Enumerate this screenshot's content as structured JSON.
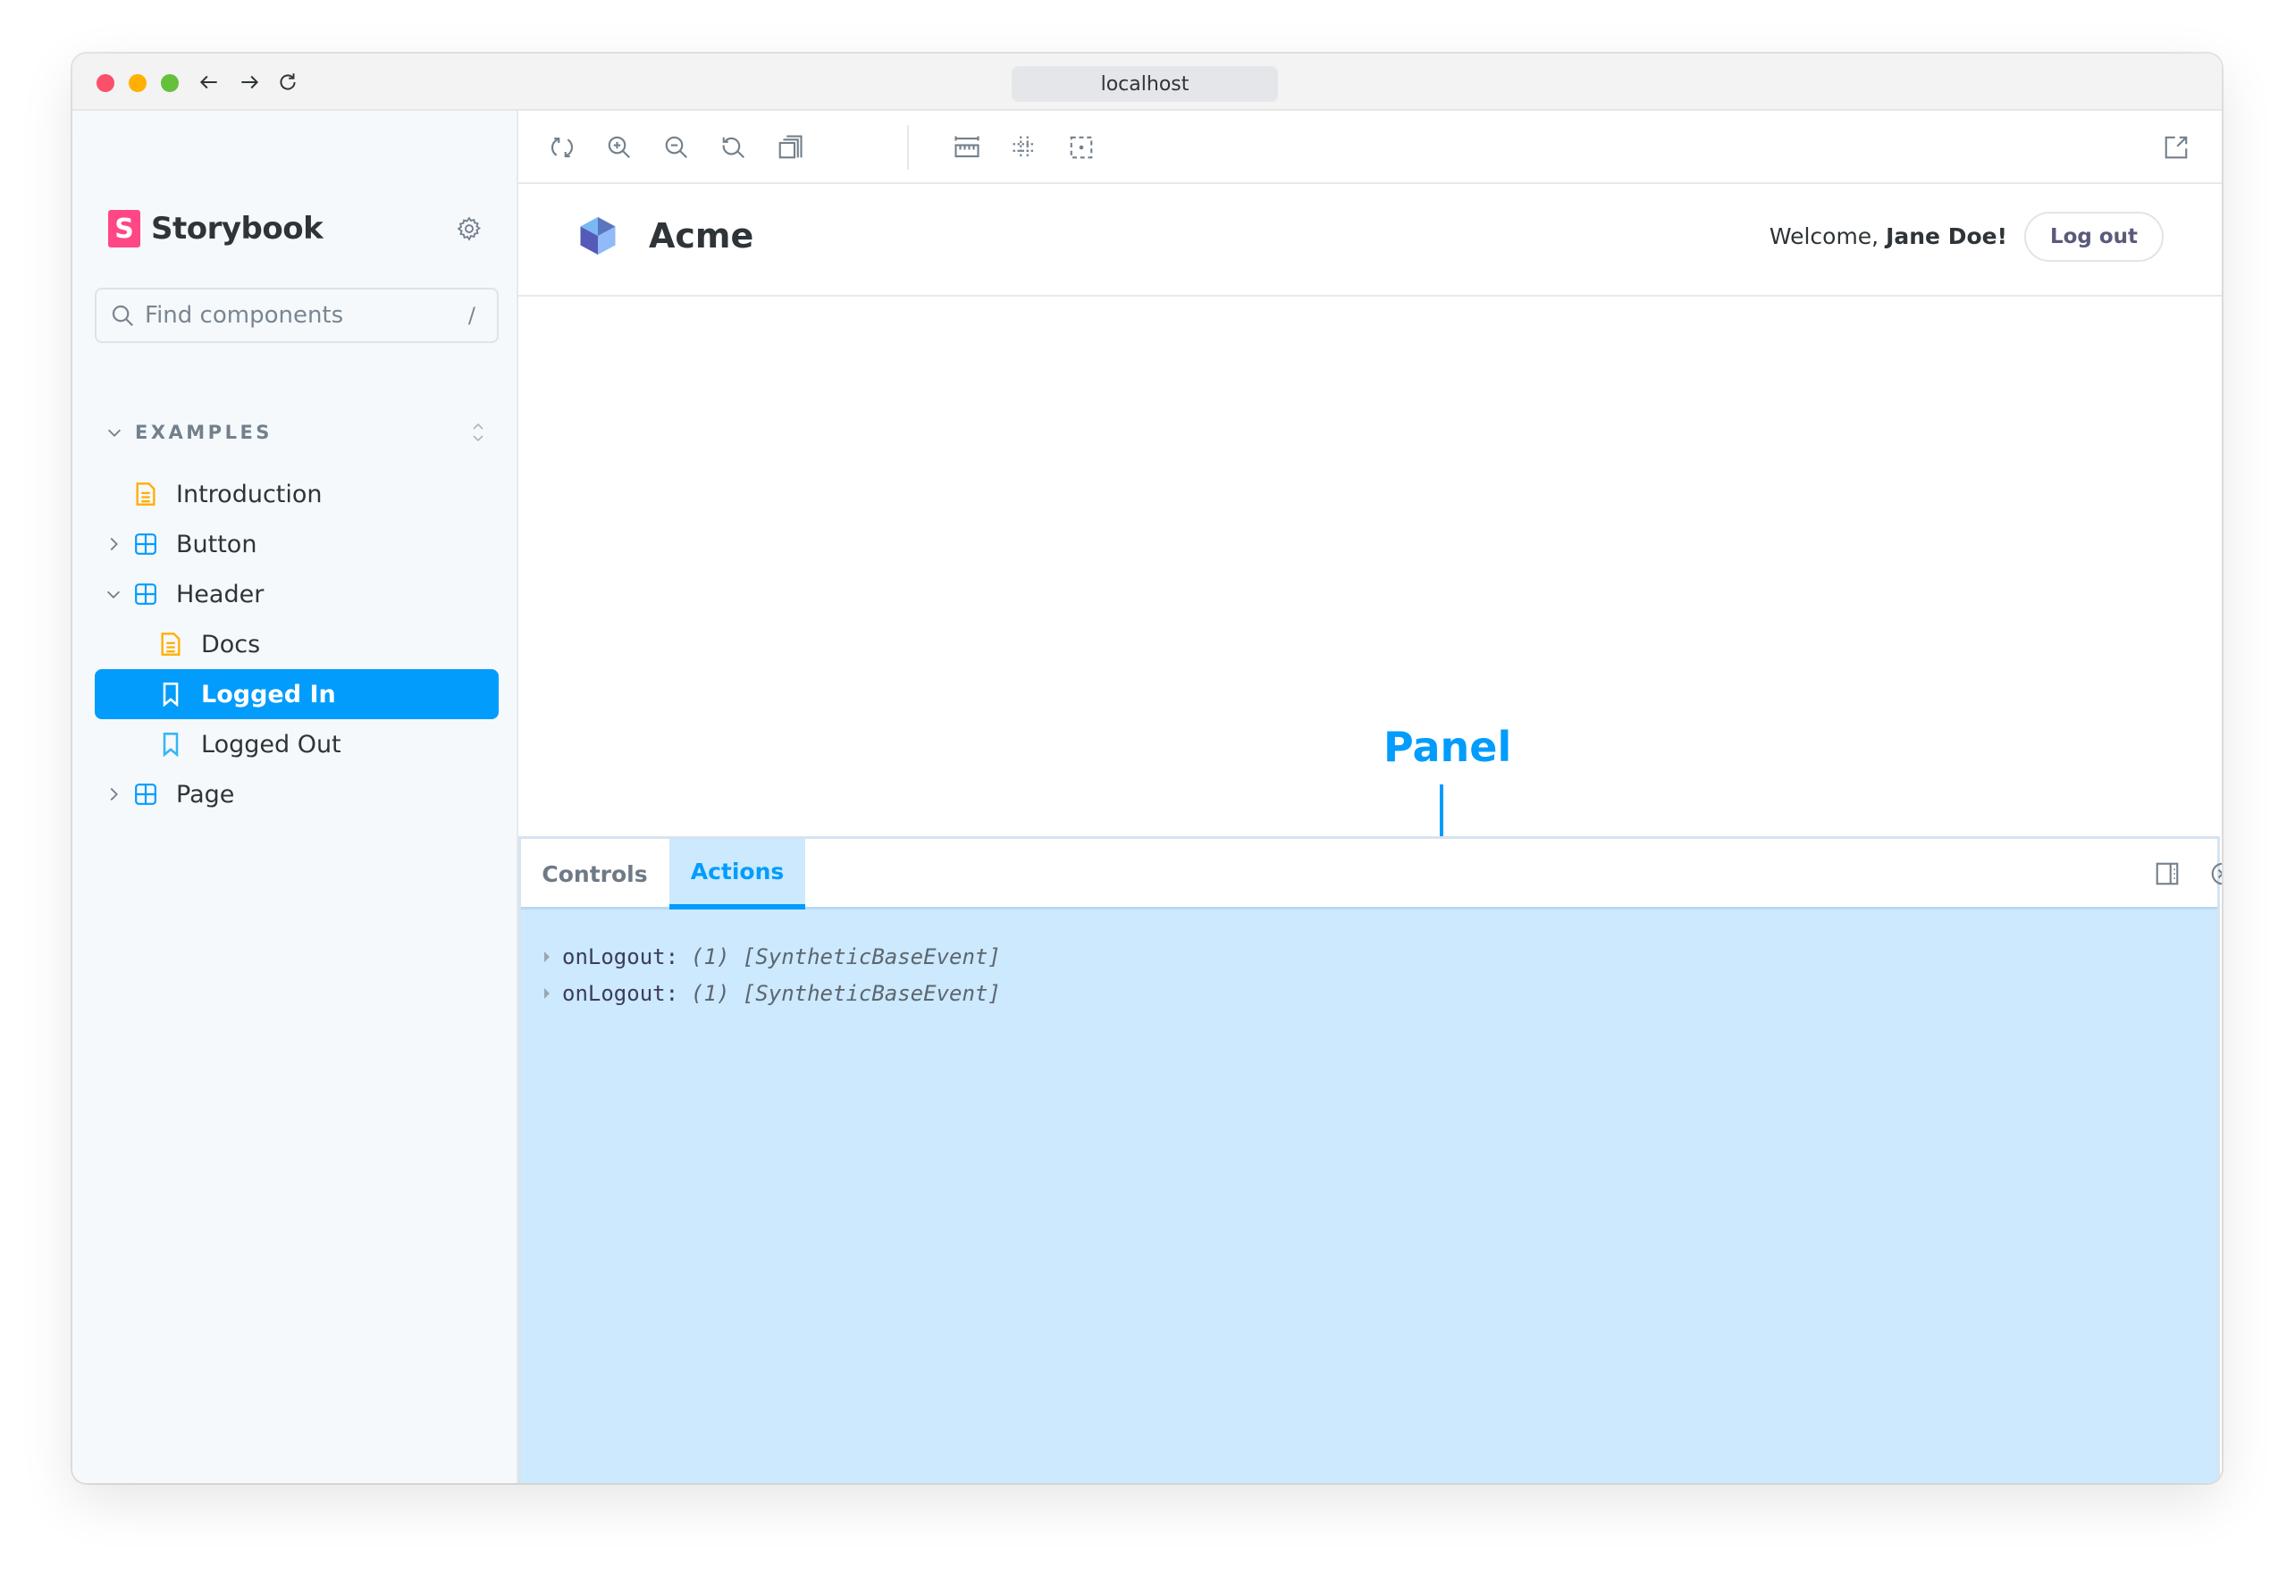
{
  "browser": {
    "url": "localhost",
    "nav": {
      "back_icon": "arrow-left-icon",
      "forward_icon": "arrow-right-icon",
      "reload_icon": "reload-icon"
    },
    "traffic_lights": {
      "close": "#fb4f6b",
      "minimize": "#ffb000",
      "zoom": "#65c03c"
    }
  },
  "sidebar": {
    "brand": {
      "logo_letter": "S",
      "name": "Storybook",
      "logo_color": "#ff4785"
    },
    "settings_icon": "gear-icon",
    "search": {
      "placeholder": "Find components",
      "value": "",
      "shortcut": "/"
    },
    "section": {
      "label": "EXAMPLES",
      "expanded": true
    },
    "items": [
      {
        "label": "Introduction",
        "type": "docs",
        "depth": 0,
        "expandable": false
      },
      {
        "label": "Button",
        "type": "component",
        "depth": 0,
        "expandable": true,
        "expanded": false
      },
      {
        "label": "Header",
        "type": "component",
        "depth": 0,
        "expandable": true,
        "expanded": true
      },
      {
        "label": "Docs",
        "type": "docs",
        "depth": 1,
        "expandable": false
      },
      {
        "label": "Logged In",
        "type": "story",
        "depth": 1,
        "selected": true
      },
      {
        "label": "Logged Out",
        "type": "story",
        "depth": 1
      },
      {
        "label": "Page",
        "type": "component",
        "depth": 0,
        "expandable": true,
        "expanded": false
      }
    ],
    "accent_color": "#029cfd"
  },
  "toolbar": {
    "left": [
      {
        "name": "remount",
        "icon": "sync-icon"
      },
      {
        "name": "zoom-in",
        "icon": "zoom-in-icon"
      },
      {
        "name": "zoom-out",
        "icon": "zoom-out-icon"
      },
      {
        "name": "reset-zoom",
        "icon": "zoom-reset-icon"
      },
      {
        "name": "background",
        "icon": "photo-stack-icon"
      },
      {
        "name": "measure",
        "icon": "ruler-icon"
      },
      {
        "name": "grid",
        "icon": "grid-outline-icon"
      },
      {
        "name": "outline",
        "icon": "outline-icon"
      }
    ],
    "right": [
      {
        "name": "open-in-new-tab",
        "icon": "share-alt-icon"
      }
    ]
  },
  "preview": {
    "app_name": "Acme",
    "welcome_prefix": "Welcome, ",
    "user_name": "Jane Doe!",
    "logout_label": "Log out"
  },
  "annotation": {
    "label": "Panel",
    "color": "#029cfd"
  },
  "panel": {
    "tabs": [
      {
        "label": "Controls",
        "active": false
      },
      {
        "label": "Actions",
        "active": true
      }
    ],
    "right_icons": [
      "sidebar-alt-icon",
      "close-circle-icon"
    ],
    "actions_log": [
      {
        "name": "onLogout:",
        "value": "(1) [SyntheticBaseEvent]"
      },
      {
        "name": "onLogout:",
        "value": "(1) [SyntheticBaseEvent]"
      }
    ],
    "highlight_color": "#cce9fd"
  }
}
